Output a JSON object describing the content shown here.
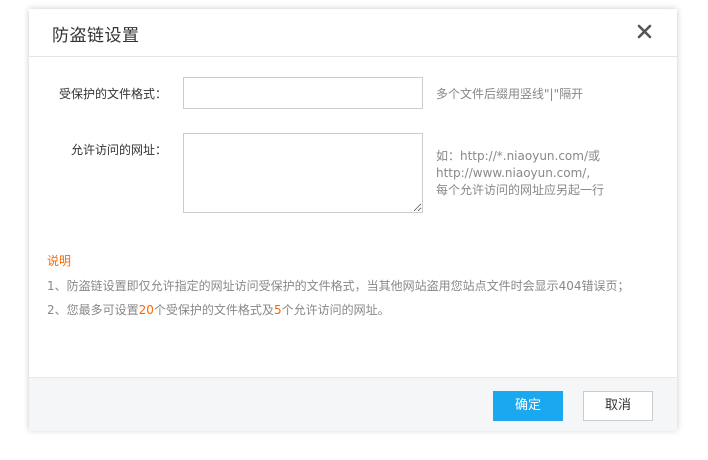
{
  "dialog": {
    "title": "防盗链设置",
    "close_icon": "close-icon"
  },
  "form": {
    "file_formats": {
      "label": "受保护的文件格式：",
      "value": "",
      "placeholder": "",
      "hint": "多个文件后缀用竖线\"|\"隔开"
    },
    "allowed_urls": {
      "label": "允许访问的网址：",
      "value": "",
      "placeholder": "",
      "hint_line1": "如：http://*.niaoyun.com/或",
      "hint_line2": "http://www.niaoyun.com/,",
      "hint_line3": "每个允许访问的网址应另起一行"
    }
  },
  "notes": {
    "title": "说明",
    "line1": "1、防盗链设置即仅允许指定的网址访问受保护的文件格式，当其他网站盗用您站点文件时会显示404错误页；",
    "line2_prefix": "2、您最多可设置",
    "line2_num1": "20",
    "line2_mid": "个受保护的文件格式及",
    "line2_num2": "5",
    "line2_suffix": "个允许访问的网址。"
  },
  "footer": {
    "confirm_label": "确定",
    "cancel_label": "取消"
  },
  "colors": {
    "accent": "#1aa8f0",
    "highlight": "#ff6600"
  }
}
